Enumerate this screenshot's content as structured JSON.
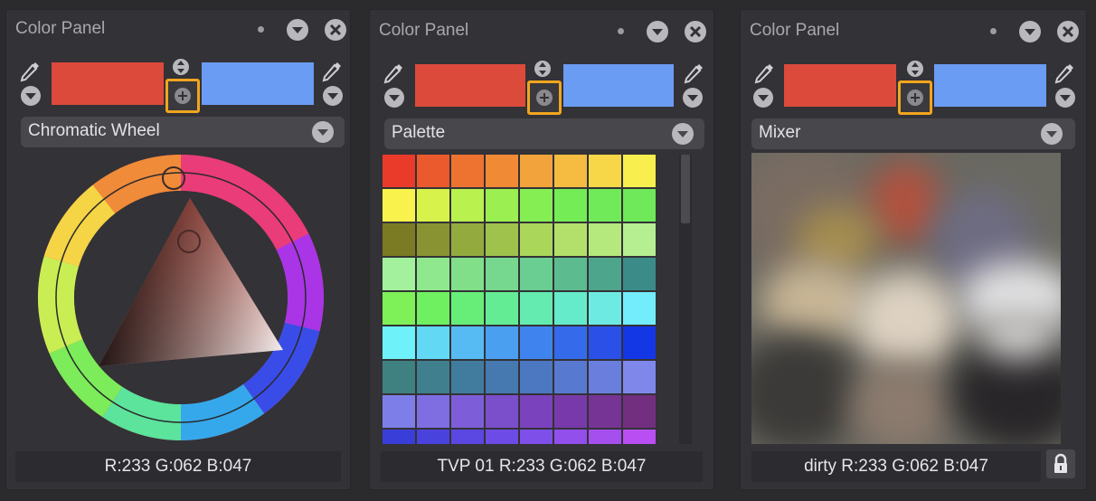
{
  "colors": {
    "primary": "#db4a3b",
    "secondary": "#6b9cf3",
    "highlight": "#f2a51e",
    "panel_bg": "#333236"
  },
  "panels": [
    {
      "title": "Color Panel",
      "mode": "Chromatic Wheel",
      "footer": "R:233 G:062 B:047"
    },
    {
      "title": "Color Panel",
      "mode": "Palette",
      "footer": "TVP 01 R:233 G:062 B:047",
      "palette": [
        [
          "#e93a2a",
          "#eb5a2c",
          "#ee7331",
          "#f08a35",
          "#f2a33b",
          "#f5bc41",
          "#f7d647",
          "#f8ef4e"
        ],
        [
          "#f9f24c",
          "#d7f24b",
          "#b9f14e",
          "#9cef50",
          "#84ee52",
          "#74ec55",
          "#70ea58",
          "#6fe85a"
        ],
        [
          "#7b7b24",
          "#8a9332",
          "#93aa3f",
          "#9ec24c",
          "#aad65a",
          "#b3e06a",
          "#b5e87d",
          "#b6ee92"
        ],
        [
          "#a3f19c",
          "#90e88e",
          "#81df8a",
          "#76d78e",
          "#6acd91",
          "#5cbc8f",
          "#4da58b",
          "#3b8c88"
        ],
        [
          "#7ef058",
          "#6ef060",
          "#67ee79",
          "#64ec95",
          "#63ebb0",
          "#66ebca",
          "#6debe3",
          "#73ecfb"
        ],
        [
          "#6ef1f8",
          "#62d8f5",
          "#57bbf3",
          "#4b9ff1",
          "#3f84ee",
          "#356aeb",
          "#2b50e8",
          "#1437e6"
        ],
        [
          "#3f8081",
          "#3f7f8e",
          "#417c9f",
          "#4579b0",
          "#4c77c1",
          "#5879d0",
          "#6a7fdd",
          "#7f88ea"
        ],
        [
          "#7e7ee9",
          "#7e6ee2",
          "#7d5ed8",
          "#7b4ecc",
          "#7a42bd",
          "#783aaa",
          "#763495",
          "#722f80"
        ],
        [
          "#3a3ed8",
          "#4a42dd",
          "#5b47e1",
          "#6d4be6",
          "#7f4fe9",
          "#924fec",
          "#a54fef",
          "#b94ff2"
        ]
      ]
    },
    {
      "title": "Color Panel",
      "mode": "Mixer",
      "footer": "dirty R:233 G:062 B:047"
    }
  ]
}
